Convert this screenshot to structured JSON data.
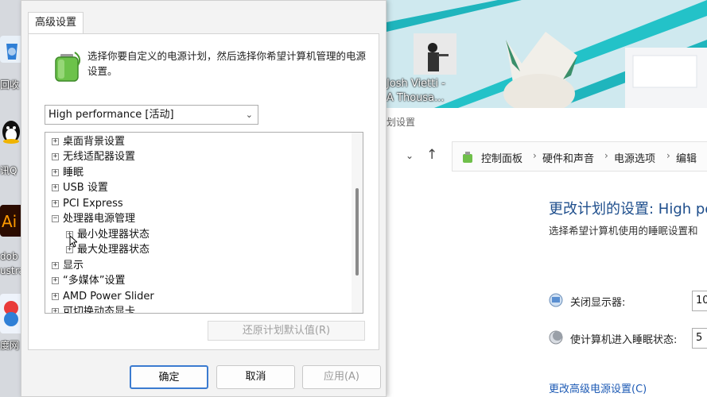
{
  "desktop": {
    "labels": [
      "回收",
      "讯Q",
      "dob",
      "ustra",
      "度网"
    ]
  },
  "dialog": {
    "tab_label": "高级设置",
    "description": "选择你要自定义的电源计划，然后选择你希望计算机管理的电源设置。",
    "plan_selected": "High performance [活动]",
    "tree_items": [
      {
        "label": "桌面背景设置",
        "expander": "+"
      },
      {
        "label": "无线适配器设置",
        "expander": "+"
      },
      {
        "label": "睡眠",
        "expander": "+"
      },
      {
        "label": "USB 设置",
        "expander": "+"
      },
      {
        "label": "PCI Express",
        "expander": "+"
      },
      {
        "label": "处理器电源管理",
        "expander": "−"
      },
      {
        "label": "最小处理器状态",
        "expander": "+"
      },
      {
        "label": "最大处理器状态",
        "expander": "+"
      },
      {
        "label": "显示",
        "expander": "+"
      },
      {
        "label": "“多媒体”设置",
        "expander": "+"
      },
      {
        "label": "AMD Power Slider",
        "expander": "+"
      },
      {
        "label": "可切换动态显卡",
        "expander": "+"
      }
    ],
    "restore_defaults": "还原计划默认值(R)",
    "ok": "确定",
    "cancel": "取消",
    "apply": "应用(A)"
  },
  "wallpaper": {
    "music_artist": "Josh Vietti -",
    "music_title": "A Thousa..."
  },
  "control_panel": {
    "window_title": "划设置",
    "breadcrumbs": [
      "控制面板",
      "硬件和声音",
      "电源选项",
      "编辑"
    ],
    "heading": "更改计划的设置: High pe",
    "subtext": "选择希望计算机使用的睡眠设置和",
    "display_off_label": "关闭显示器:",
    "display_off_value": "10",
    "sleep_label": "使计算机进入睡眠状态:",
    "sleep_value": "5",
    "advanced_link": "更改高级电源设置(C)"
  },
  "colors": {
    "accent": "#3b7bd0",
    "link": "#1e5bb5",
    "heading": "#1e4e8c"
  }
}
